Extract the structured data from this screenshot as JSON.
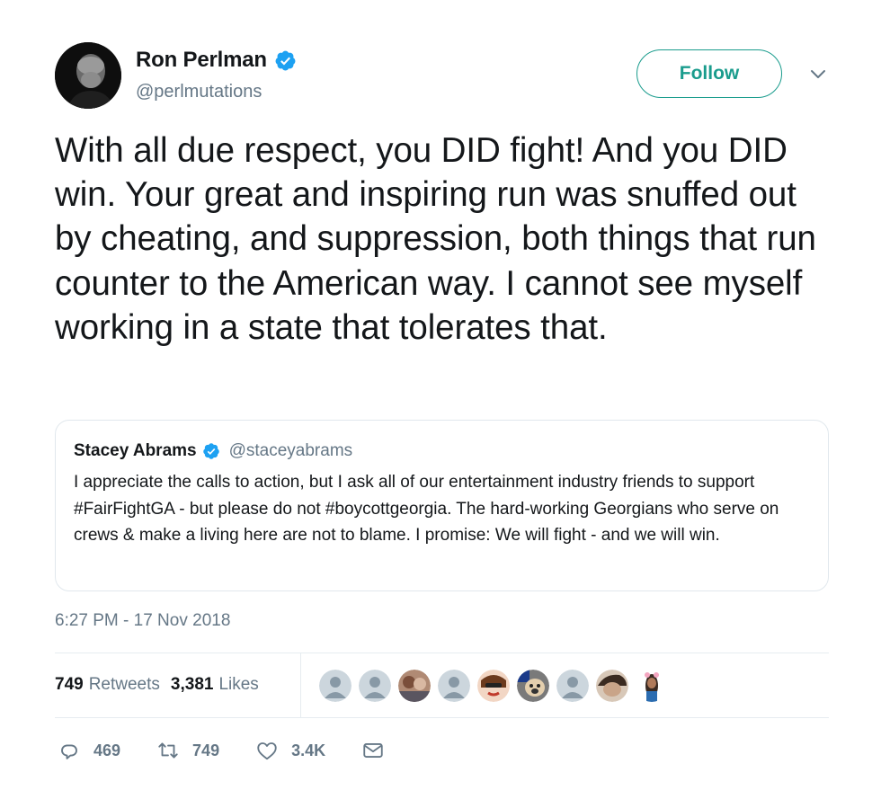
{
  "author": {
    "display_name": "Ron Perlman",
    "handle": "@perlmutations",
    "verified": true
  },
  "follow_button": {
    "label": "Follow"
  },
  "tweet": {
    "text": "With all due respect, you DID fight! And you DID win. Your great and inspiring run was snuffed out by cheating, and suppression, both things that run counter to the American way. I cannot see myself working in a state that tolerates that."
  },
  "quoted_tweet": {
    "display_name": "Stacey Abrams",
    "handle": "@staceyabrams",
    "verified": true,
    "text": "I appreciate the calls to action, but I ask all of our entertainment industry friends to support #FairFightGA - but please do not #boycottgeorgia. The hard-working Georgians who serve on crews & make a living here are not to blame. I promise: We will fight - and we will win."
  },
  "timestamp": "6:27 PM - 17 Nov 2018",
  "stats": {
    "retweets_count": "749",
    "retweets_label": "Retweets",
    "likes_count": "3,381",
    "likes_label": "Likes"
  },
  "actions": {
    "reply_count": "469",
    "retweet_count": "749",
    "like_count": "3.4K"
  },
  "colors": {
    "follow_accent": "#1a9c8d",
    "verified_blue": "#1da1f2",
    "secondary_text": "#657786",
    "primary_text": "#14171a"
  }
}
